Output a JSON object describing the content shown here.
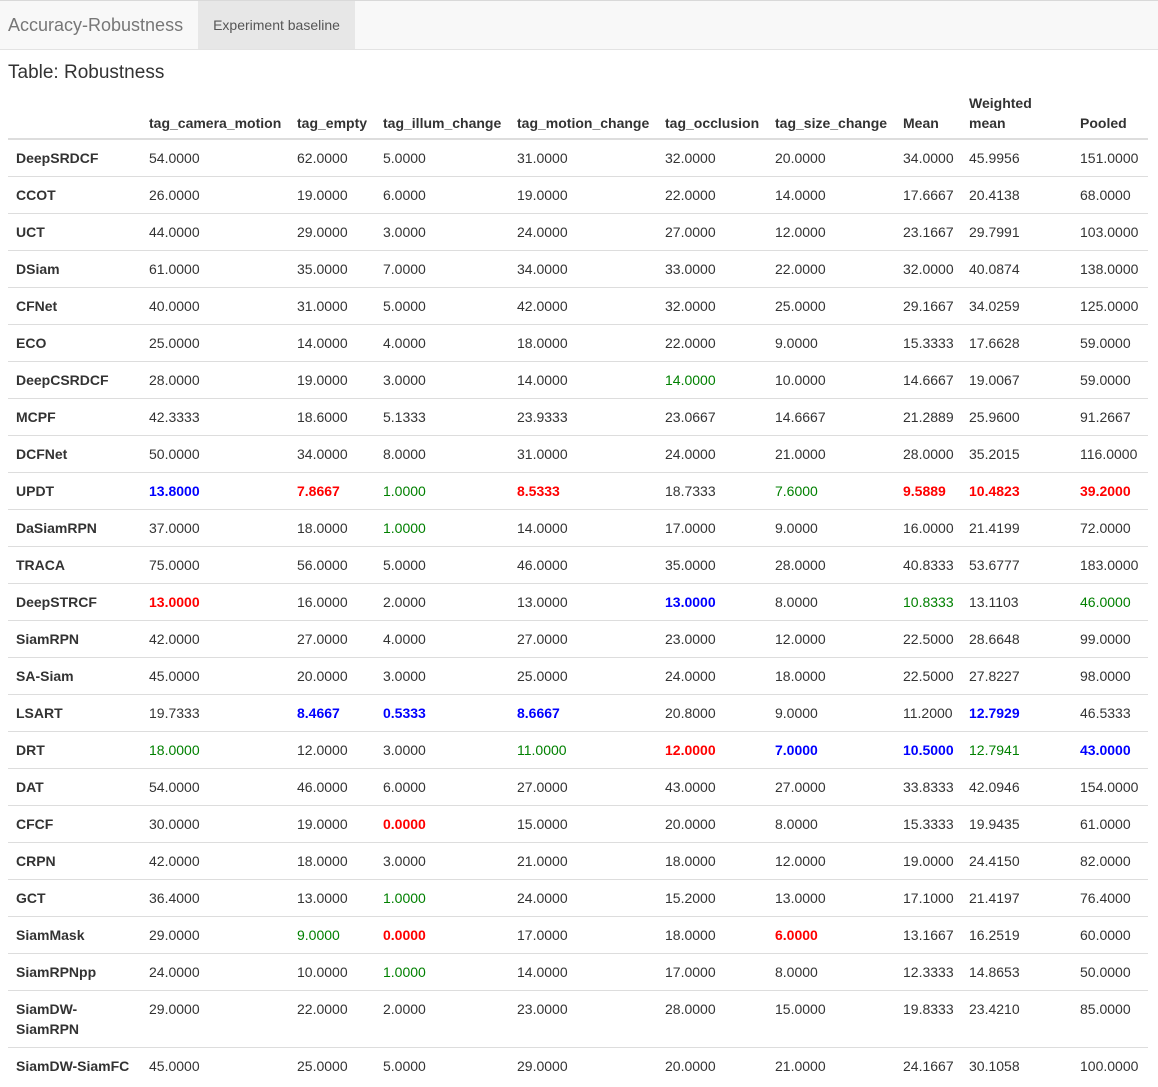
{
  "navbar": {
    "brand": "Accuracy-Robustness",
    "active_tab": "Experiment baseline"
  },
  "page": {
    "title": "Table: Robustness"
  },
  "colors": {
    "first": "#ff0000",
    "second": "#0000ff",
    "third": "#008000"
  },
  "table": {
    "columns": [
      "",
      "tag_camera_motion",
      "tag_empty",
      "tag_illum_change",
      "tag_motion_change",
      "tag_occlusion",
      "tag_size_change",
      "Mean",
      "Weighted mean",
      "Pooled"
    ],
    "rows": [
      {
        "name": "DeepSRDCF",
        "values": [
          "54.0000",
          "62.0000",
          "5.0000",
          "31.0000",
          "32.0000",
          "20.0000",
          "34.0000",
          "45.9956",
          "151.0000"
        ],
        "ranks": [
          0,
          0,
          0,
          0,
          0,
          0,
          0,
          0,
          0
        ]
      },
      {
        "name": "CCOT",
        "values": [
          "26.0000",
          "19.0000",
          "6.0000",
          "19.0000",
          "22.0000",
          "14.0000",
          "17.6667",
          "20.4138",
          "68.0000"
        ],
        "ranks": [
          0,
          0,
          0,
          0,
          0,
          0,
          0,
          0,
          0
        ]
      },
      {
        "name": "UCT",
        "values": [
          "44.0000",
          "29.0000",
          "3.0000",
          "24.0000",
          "27.0000",
          "12.0000",
          "23.1667",
          "29.7991",
          "103.0000"
        ],
        "ranks": [
          0,
          0,
          0,
          0,
          0,
          0,
          0,
          0,
          0
        ]
      },
      {
        "name": "DSiam",
        "values": [
          "61.0000",
          "35.0000",
          "7.0000",
          "34.0000",
          "33.0000",
          "22.0000",
          "32.0000",
          "40.0874",
          "138.0000"
        ],
        "ranks": [
          0,
          0,
          0,
          0,
          0,
          0,
          0,
          0,
          0
        ]
      },
      {
        "name": "CFNet",
        "values": [
          "40.0000",
          "31.0000",
          "5.0000",
          "42.0000",
          "32.0000",
          "25.0000",
          "29.1667",
          "34.0259",
          "125.0000"
        ],
        "ranks": [
          0,
          0,
          0,
          0,
          0,
          0,
          0,
          0,
          0
        ]
      },
      {
        "name": "ECO",
        "values": [
          "25.0000",
          "14.0000",
          "4.0000",
          "18.0000",
          "22.0000",
          "9.0000",
          "15.3333",
          "17.6628",
          "59.0000"
        ],
        "ranks": [
          0,
          0,
          0,
          0,
          0,
          0,
          0,
          0,
          0
        ]
      },
      {
        "name": "DeepCSRDCF",
        "values": [
          "28.0000",
          "19.0000",
          "3.0000",
          "14.0000",
          "14.0000",
          "10.0000",
          "14.6667",
          "19.0067",
          "59.0000"
        ],
        "ranks": [
          0,
          0,
          0,
          0,
          3,
          0,
          0,
          0,
          0
        ]
      },
      {
        "name": "MCPF",
        "values": [
          "42.3333",
          "18.6000",
          "5.1333",
          "23.9333",
          "23.0667",
          "14.6667",
          "21.2889",
          "25.9600",
          "91.2667"
        ],
        "ranks": [
          0,
          0,
          0,
          0,
          0,
          0,
          0,
          0,
          0
        ]
      },
      {
        "name": "DCFNet",
        "values": [
          "50.0000",
          "34.0000",
          "8.0000",
          "31.0000",
          "24.0000",
          "21.0000",
          "28.0000",
          "35.2015",
          "116.0000"
        ],
        "ranks": [
          0,
          0,
          0,
          0,
          0,
          0,
          0,
          0,
          0
        ]
      },
      {
        "name": "UPDT",
        "values": [
          "13.8000",
          "7.8667",
          "1.0000",
          "8.5333",
          "18.7333",
          "7.6000",
          "9.5889",
          "10.4823",
          "39.2000"
        ],
        "ranks": [
          2,
          1,
          3,
          1,
          0,
          3,
          1,
          1,
          1
        ]
      },
      {
        "name": "DaSiamRPN",
        "values": [
          "37.0000",
          "18.0000",
          "1.0000",
          "14.0000",
          "17.0000",
          "9.0000",
          "16.0000",
          "21.4199",
          "72.0000"
        ],
        "ranks": [
          0,
          0,
          3,
          0,
          0,
          0,
          0,
          0,
          0
        ]
      },
      {
        "name": "TRACA",
        "values": [
          "75.0000",
          "56.0000",
          "5.0000",
          "46.0000",
          "35.0000",
          "28.0000",
          "40.8333",
          "53.6777",
          "183.0000"
        ],
        "ranks": [
          0,
          0,
          0,
          0,
          0,
          0,
          0,
          0,
          0
        ]
      },
      {
        "name": "DeepSTRCF",
        "values": [
          "13.0000",
          "16.0000",
          "2.0000",
          "13.0000",
          "13.0000",
          "8.0000",
          "10.8333",
          "13.1103",
          "46.0000"
        ],
        "ranks": [
          1,
          0,
          0,
          0,
          2,
          0,
          3,
          0,
          3
        ]
      },
      {
        "name": "SiamRPN",
        "values": [
          "42.0000",
          "27.0000",
          "4.0000",
          "27.0000",
          "23.0000",
          "12.0000",
          "22.5000",
          "28.6648",
          "99.0000"
        ],
        "ranks": [
          0,
          0,
          0,
          0,
          0,
          0,
          0,
          0,
          0
        ]
      },
      {
        "name": "SA-Siam",
        "values": [
          "45.0000",
          "20.0000",
          "3.0000",
          "25.0000",
          "24.0000",
          "18.0000",
          "22.5000",
          "27.8227",
          "98.0000"
        ],
        "ranks": [
          0,
          0,
          0,
          0,
          0,
          0,
          0,
          0,
          0
        ]
      },
      {
        "name": "LSART",
        "values": [
          "19.7333",
          "8.4667",
          "0.5333",
          "8.6667",
          "20.8000",
          "9.0000",
          "11.2000",
          "12.7929",
          "46.5333"
        ],
        "ranks": [
          0,
          2,
          2,
          2,
          0,
          0,
          0,
          2,
          0
        ]
      },
      {
        "name": "DRT",
        "values": [
          "18.0000",
          "12.0000",
          "3.0000",
          "11.0000",
          "12.0000",
          "7.0000",
          "10.5000",
          "12.7941",
          "43.0000"
        ],
        "ranks": [
          3,
          0,
          0,
          3,
          1,
          2,
          2,
          3,
          2
        ]
      },
      {
        "name": "DAT",
        "values": [
          "54.0000",
          "46.0000",
          "6.0000",
          "27.0000",
          "43.0000",
          "27.0000",
          "33.8333",
          "42.0946",
          "154.0000"
        ],
        "ranks": [
          0,
          0,
          0,
          0,
          0,
          0,
          0,
          0,
          0
        ]
      },
      {
        "name": "CFCF",
        "values": [
          "30.0000",
          "19.0000",
          "0.0000",
          "15.0000",
          "20.0000",
          "8.0000",
          "15.3333",
          "19.9435",
          "61.0000"
        ],
        "ranks": [
          0,
          0,
          1,
          0,
          0,
          0,
          0,
          0,
          0
        ]
      },
      {
        "name": "CRPN",
        "values": [
          "42.0000",
          "18.0000",
          "3.0000",
          "21.0000",
          "18.0000",
          "12.0000",
          "19.0000",
          "24.4150",
          "82.0000"
        ],
        "ranks": [
          0,
          0,
          0,
          0,
          0,
          0,
          0,
          0,
          0
        ]
      },
      {
        "name": "GCT",
        "values": [
          "36.4000",
          "13.0000",
          "1.0000",
          "24.0000",
          "15.2000",
          "13.0000",
          "17.1000",
          "21.4197",
          "76.4000"
        ],
        "ranks": [
          0,
          0,
          3,
          0,
          0,
          0,
          0,
          0,
          0
        ]
      },
      {
        "name": "SiamMask",
        "values": [
          "29.0000",
          "9.0000",
          "0.0000",
          "17.0000",
          "18.0000",
          "6.0000",
          "13.1667",
          "16.2519",
          "60.0000"
        ],
        "ranks": [
          0,
          3,
          1,
          0,
          0,
          1,
          0,
          0,
          0
        ]
      },
      {
        "name": "SiamRPNpp",
        "values": [
          "24.0000",
          "10.0000",
          "1.0000",
          "14.0000",
          "17.0000",
          "8.0000",
          "12.3333",
          "14.8653",
          "50.0000"
        ],
        "ranks": [
          0,
          0,
          3,
          0,
          0,
          0,
          0,
          0,
          0
        ]
      },
      {
        "name": "SiamDW-SiamRPN",
        "values": [
          "29.0000",
          "22.0000",
          "2.0000",
          "23.0000",
          "28.0000",
          "15.0000",
          "19.8333",
          "23.4210",
          "85.0000"
        ],
        "ranks": [
          0,
          0,
          0,
          0,
          0,
          0,
          0,
          0,
          0
        ]
      },
      {
        "name": "SiamDW-SiamFC",
        "values": [
          "45.0000",
          "25.0000",
          "5.0000",
          "29.0000",
          "20.0000",
          "21.0000",
          "24.1667",
          "30.1058",
          "100.0000"
        ],
        "ranks": [
          0,
          0,
          0,
          0,
          0,
          0,
          0,
          0,
          0
        ]
      }
    ]
  }
}
